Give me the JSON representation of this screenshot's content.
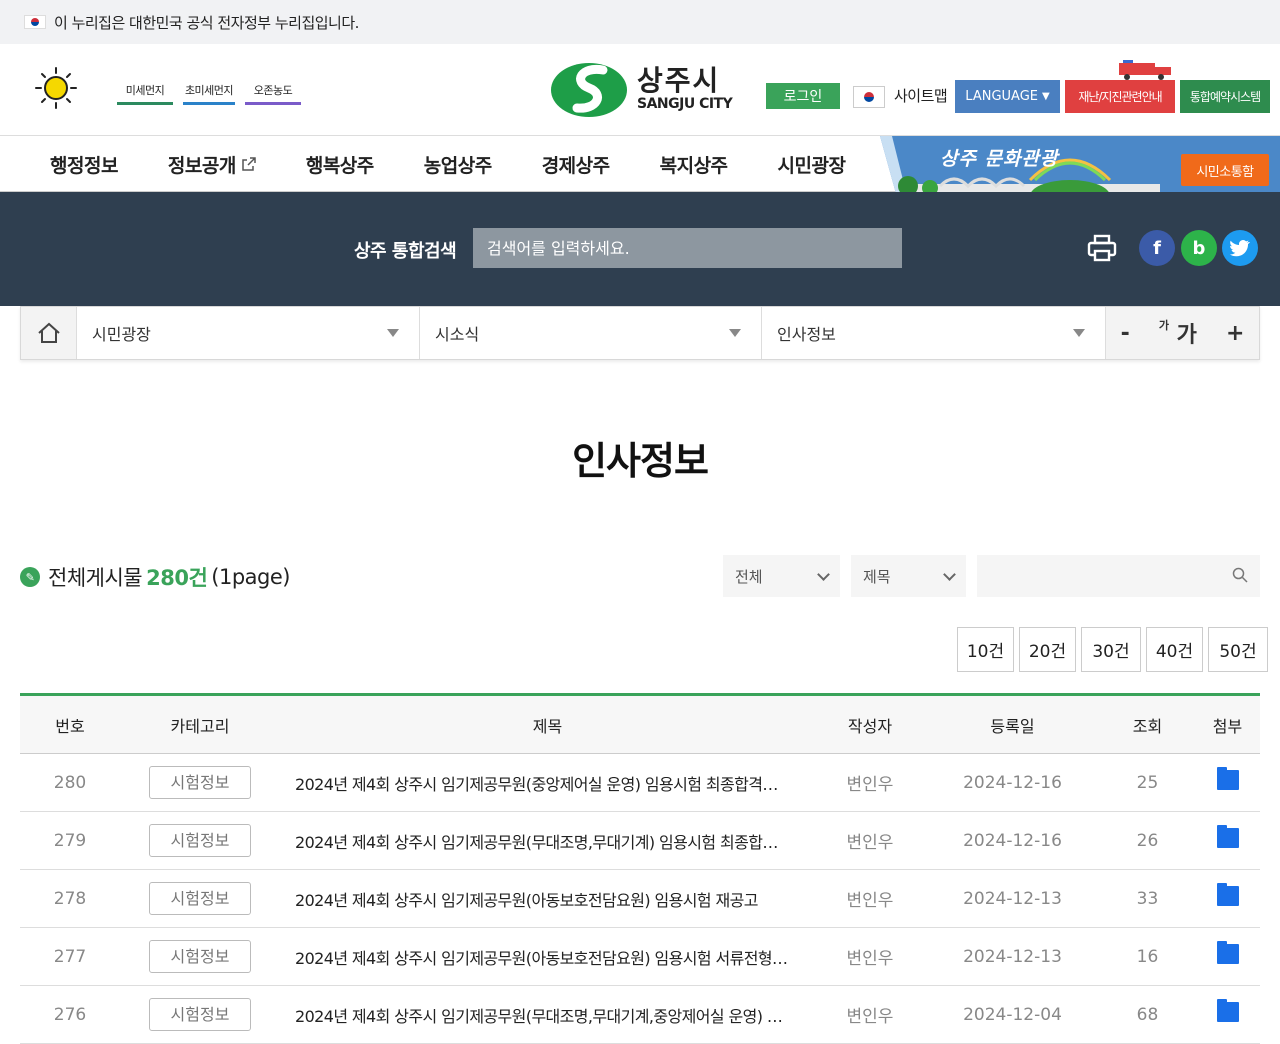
{
  "gov_banner": {
    "text": "이 누리집은 대한민국 공식 전자정부 누리집입니다."
  },
  "header": {
    "air_quality": [
      "미세먼지",
      "초미세먼지",
      "오존농도"
    ],
    "logo_ko": "상주시",
    "logo_en": "SANGJU CITY",
    "login": "로그인",
    "sitemap": "사이트맵",
    "language": "LANGUAGE",
    "disaster": "재난/지진관련안내",
    "booking": "통합예약시스템"
  },
  "nav": {
    "items": [
      "행정정보",
      "정보공개",
      "행복상주",
      "농업상주",
      "경제상주",
      "복지상주",
      "시민광장"
    ],
    "promo_text": "상주 문화관광",
    "promo_button": "시민소통함"
  },
  "search": {
    "label": "상주 통합검색",
    "placeholder": "검색어를 입력하세요."
  },
  "breadcrumb": [
    "시민광장",
    "시소식",
    "인사정보"
  ],
  "font_control": {
    "minus": "-",
    "label_small": "가",
    "label_large": "가",
    "plus": "+"
  },
  "page_title": "인사정보",
  "board": {
    "count_prefix": "전체게시물",
    "count_value": "280건",
    "count_suffix": "(1page)",
    "filter_scope": "전체",
    "filter_field": "제목",
    "per_page": [
      "10건",
      "20건",
      "30건",
      "40건",
      "50건"
    ],
    "columns": [
      "번호",
      "카테고리",
      "제목",
      "작성자",
      "등록일",
      "조회",
      "첨부"
    ],
    "rows": [
      {
        "no": "280",
        "category": "시험정보",
        "title": "2024년 제4회 상주시 임기제공무원(중앙제어실 운영) 임용시험 최종합격…",
        "author": "변인우",
        "date": "2024-12-16",
        "views": "25"
      },
      {
        "no": "279",
        "category": "시험정보",
        "title": "2024년 제4회 상주시 임기제공무원(무대조명,무대기계) 임용시험 최종합…",
        "author": "변인우",
        "date": "2024-12-16",
        "views": "26"
      },
      {
        "no": "278",
        "category": "시험정보",
        "title": "2024년 제4회 상주시 임기제공무원(아동보호전담요원) 임용시험 재공고",
        "author": "변인우",
        "date": "2024-12-13",
        "views": "33"
      },
      {
        "no": "277",
        "category": "시험정보",
        "title": "2024년 제4회 상주시 임기제공무원(아동보호전담요원) 임용시험 서류전형…",
        "author": "변인우",
        "date": "2024-12-13",
        "views": "16"
      },
      {
        "no": "276",
        "category": "시험정보",
        "title": "2024년 제4회 상주시 임기제공무원(무대조명,무대기계,중앙제어실 운영) …",
        "author": "변인우",
        "date": "2024-12-04",
        "views": "68"
      }
    ]
  }
}
